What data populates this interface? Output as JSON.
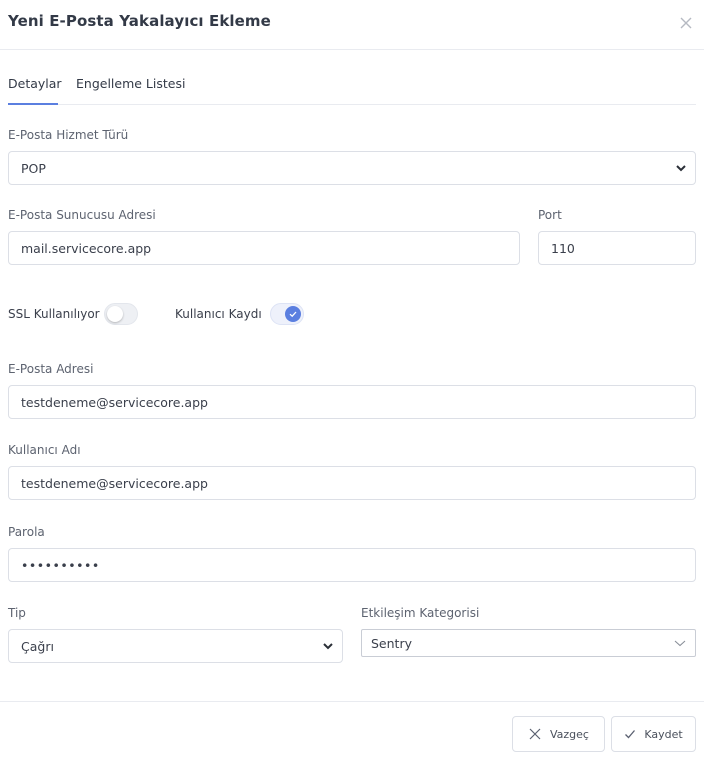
{
  "dialog": {
    "title": "Yeni E-Posta Yakalayıcı Ekleme"
  },
  "tabs": [
    {
      "label": "Detaylar",
      "active": true
    },
    {
      "label": "Engelleme Listesi",
      "active": false
    }
  ],
  "form": {
    "service_type": {
      "label": "E-Posta Hizmet Türü",
      "value": "POP"
    },
    "server_address": {
      "label": "E-Posta Sunucusu Adresi",
      "value": "mail.servicecore.app"
    },
    "port": {
      "label": "Port",
      "value": "110"
    },
    "ssl": {
      "label": "SSL Kullanılıyor",
      "enabled": false
    },
    "user_record": {
      "label": "Kullanıcı Kaydı",
      "enabled": true
    },
    "email": {
      "label": "E-Posta Adresi",
      "value": "testdeneme@servicecore.app"
    },
    "username": {
      "label": "Kullanıcı Adı",
      "value": "testdeneme@servicecore.app"
    },
    "password": {
      "label": "Parola",
      "value": "••••••••••"
    },
    "type": {
      "label": "Tip",
      "value": "Çağrı"
    },
    "interaction_category": {
      "label": "Etkileşim Kategorisi",
      "value": "Sentry"
    }
  },
  "footer": {
    "cancel_label": "Vazgeç",
    "save_label": "Kaydet"
  },
  "colors": {
    "accent": "#5b7fe0",
    "border": "#dcdfe6",
    "text": "#3a3f4b"
  }
}
